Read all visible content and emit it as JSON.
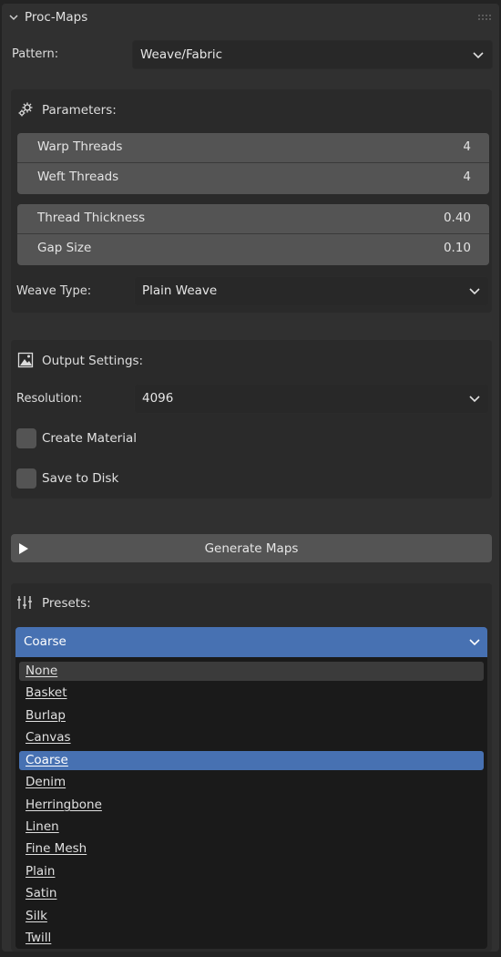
{
  "panel": {
    "title": "Proc-Maps"
  },
  "pattern": {
    "label": "Pattern:",
    "value": "Weave/Fabric"
  },
  "parameters": {
    "title": "Parameters:",
    "fields": [
      {
        "label": "Warp Threads",
        "value": "4"
      },
      {
        "label": "Weft Threads",
        "value": "4"
      },
      {
        "label": "Thread Thickness",
        "value": "0.40"
      },
      {
        "label": "Gap Size",
        "value": "0.10"
      }
    ],
    "weave_type": {
      "label": "Weave Type:",
      "value": "Plain Weave"
    }
  },
  "output": {
    "title": "Output Settings:",
    "resolution": {
      "label": "Resolution:",
      "value": "4096"
    },
    "create_material": {
      "label": "Create Material",
      "checked": false
    },
    "save_to_disk": {
      "label": "Save to Disk",
      "checked": false
    }
  },
  "generate": {
    "label": "Generate Maps"
  },
  "presets": {
    "title": "Presets:",
    "selected": "Coarse",
    "options": [
      "None",
      "Basket",
      "Burlap",
      "Canvas",
      "Coarse",
      "Denim",
      "Herringbone",
      "Linen",
      "Fine Mesh",
      "Plain",
      "Satin",
      "Silk",
      "Twill"
    ],
    "hovered": "None"
  },
  "colors": {
    "accent": "#4771b2",
    "panel": "#303030",
    "field": "#545454",
    "menu": "#1a1a1a"
  }
}
